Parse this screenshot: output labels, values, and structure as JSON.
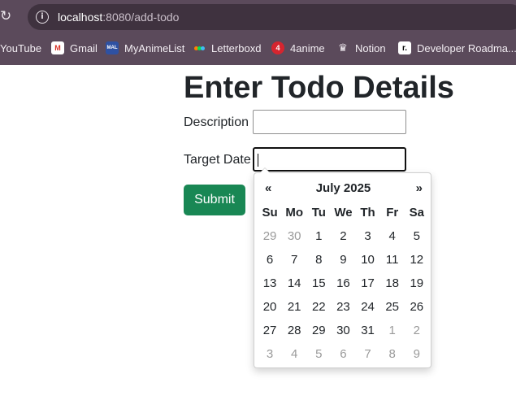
{
  "browser": {
    "url_host": "localhost",
    "url_rest": ":8080/add-todo",
    "bookmarks": [
      {
        "label": "YouTube",
        "icon": "youtube-icon"
      },
      {
        "label": "Gmail",
        "icon": "gmail-icon"
      },
      {
        "label": "MyAnimeList",
        "icon": "myanimelist-icon",
        "badge": "MAL"
      },
      {
        "label": "Letterboxd",
        "icon": "letterboxd-icon"
      },
      {
        "label": "4anime",
        "icon": "4anime-icon",
        "badge": "4"
      },
      {
        "label": "Notion",
        "icon": "notion-icon"
      },
      {
        "label": "Developer Roadma...",
        "icon": "roadmap-icon",
        "badge": "r."
      }
    ]
  },
  "form": {
    "heading": "Enter Todo Details",
    "description_label": "Description",
    "description_value": "",
    "target_date_label": "Target Date",
    "target_date_value": "",
    "submit_label": "Submit"
  },
  "datepicker": {
    "prev": "«",
    "next": "»",
    "month_title": "July 2025",
    "weekdays": [
      "Su",
      "Mo",
      "Tu",
      "We",
      "Th",
      "Fr",
      "Sa"
    ],
    "weeks": [
      [
        {
          "d": "29",
          "m": true
        },
        {
          "d": "30",
          "m": true
        },
        {
          "d": "1"
        },
        {
          "d": "2"
        },
        {
          "d": "3"
        },
        {
          "d": "4"
        },
        {
          "d": "5"
        }
      ],
      [
        {
          "d": "6"
        },
        {
          "d": "7"
        },
        {
          "d": "8"
        },
        {
          "d": "9"
        },
        {
          "d": "10"
        },
        {
          "d": "11"
        },
        {
          "d": "12"
        }
      ],
      [
        {
          "d": "13"
        },
        {
          "d": "14"
        },
        {
          "d": "15"
        },
        {
          "d": "16"
        },
        {
          "d": "17"
        },
        {
          "d": "18"
        },
        {
          "d": "19"
        }
      ],
      [
        {
          "d": "20"
        },
        {
          "d": "21"
        },
        {
          "d": "22"
        },
        {
          "d": "23"
        },
        {
          "d": "24"
        },
        {
          "d": "25"
        },
        {
          "d": "26"
        }
      ],
      [
        {
          "d": "27"
        },
        {
          "d": "28"
        },
        {
          "d": "29"
        },
        {
          "d": "30"
        },
        {
          "d": "31"
        },
        {
          "d": "1",
          "m": true
        },
        {
          "d": "2",
          "m": true
        }
      ],
      [
        {
          "d": "3",
          "m": true
        },
        {
          "d": "4",
          "m": true
        },
        {
          "d": "5",
          "m": true
        },
        {
          "d": "6",
          "m": true
        },
        {
          "d": "7",
          "m": true
        },
        {
          "d": "8",
          "m": true
        },
        {
          "d": "9",
          "m": true
        }
      ]
    ]
  }
}
